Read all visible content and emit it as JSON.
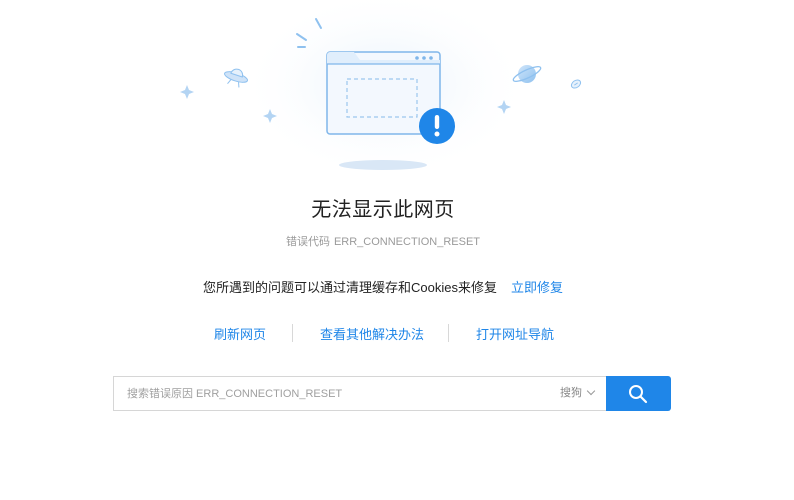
{
  "error": {
    "title": "无法显示此网页",
    "code_label": "错误代码",
    "code": "ERR_CONNECTION_RESET"
  },
  "hint": {
    "text": "您所遇到的问题可以通过清理缓存和Cookies来修复",
    "fix_link": "立即修复"
  },
  "actions": [
    {
      "label": "刷新网页"
    },
    {
      "label": "查看其他解决办法"
    },
    {
      "label": "打开网址导航"
    }
  ],
  "search": {
    "placeholder": "搜索错误原因 ERR_CONNECTION_RESET",
    "engine": "搜狗",
    "button_icon": "search-icon"
  },
  "colors": {
    "accent": "#1f86e8",
    "alert": "#1f86e8",
    "text": "#222222",
    "muted": "#9a9a9a"
  }
}
